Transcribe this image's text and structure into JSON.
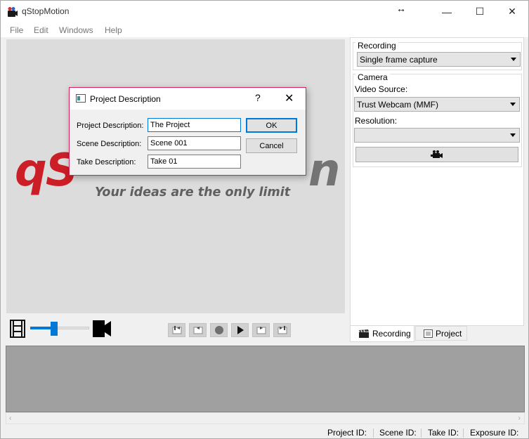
{
  "window": {
    "title": "qStopMotion",
    "resize_glyph": "↔",
    "minimize": "—",
    "maximize": "☐",
    "close": "✕"
  },
  "menu": [
    "File",
    "Edit",
    "Windows",
    "Help"
  ],
  "preview": {
    "logo_left": "qS",
    "logo_right": "n",
    "tagline": "Your ideas are the only limit"
  },
  "recording_group": {
    "title": "Recording",
    "mode_value": "Single frame capture"
  },
  "camera_group": {
    "title": "Camera",
    "video_source_label": "Video Source:",
    "video_source_value": "Trust Webcam (MMF)",
    "resolution_label": "Resolution:",
    "resolution_value": ""
  },
  "tabs": {
    "recording": "Recording",
    "project": "Project"
  },
  "frame_slider": {
    "level": 0.4
  },
  "status": {
    "project_id": "Project ID:",
    "scene_id": "Scene ID:",
    "take_id": "Take ID:",
    "exposure_id": "Exposure ID:"
  },
  "dialog": {
    "title": "Project Description",
    "help": "?",
    "close": "✕",
    "project_label": "Project Description:",
    "project_value": "The Project",
    "scene_label": "Scene Description:",
    "scene_value": "Scene 001",
    "take_label": "Take Description:",
    "take_value": "Take 01",
    "ok": "OK",
    "cancel": "Cancel"
  },
  "colors": {
    "accent": "#0078d7",
    "logo_red": "#cc1e26",
    "dialog_border": "#d4225a"
  }
}
